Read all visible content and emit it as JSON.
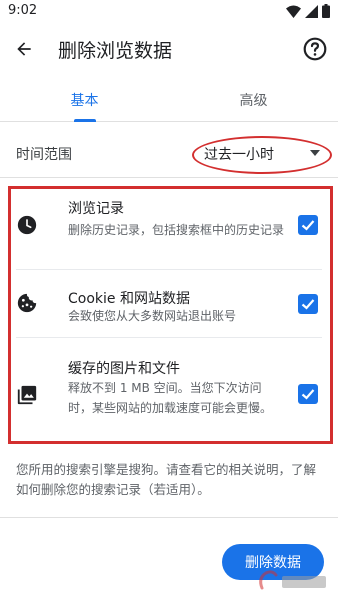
{
  "status_bar": {
    "time": "9:02",
    "icons": [
      "wifi-icon",
      "signal-icon",
      "battery-icon"
    ]
  },
  "app_bar": {
    "title": "删除浏览数据",
    "back_icon": "arrow-back-icon",
    "help_icon": "help-circle-icon"
  },
  "tabs": [
    {
      "label": "基本",
      "selected": true
    },
    {
      "label": "高级",
      "selected": false
    }
  ],
  "time_range": {
    "label": "时间范围",
    "value": "过去一小时"
  },
  "options": [
    {
      "icon": "clock-icon",
      "title": "浏览记录",
      "description": "删除历史记录，包括搜索框中的历史记录",
      "checked": true
    },
    {
      "icon": "cookie-icon",
      "title": "Cookie 和网站数据",
      "description": "会致使您从大多数网站退出账号",
      "checked": true
    },
    {
      "icon": "image-icon",
      "title": "缓存的图片和文件",
      "description": "释放不到 1 MB 空间。当您下次访问时，某些网站的加载速度可能会更慢。",
      "checked": true
    }
  ],
  "search_note": "您所用的搜索引擎是搜狗。请查看它的相关说明，了解如何删除您的搜索记录（若适用）。",
  "clear_button": {
    "label": "删除数据"
  },
  "colors": {
    "accent": "#1a73e8",
    "annotation": "#d32f2f",
    "text_primary": "#202124",
    "text_secondary": "#5f6368"
  }
}
